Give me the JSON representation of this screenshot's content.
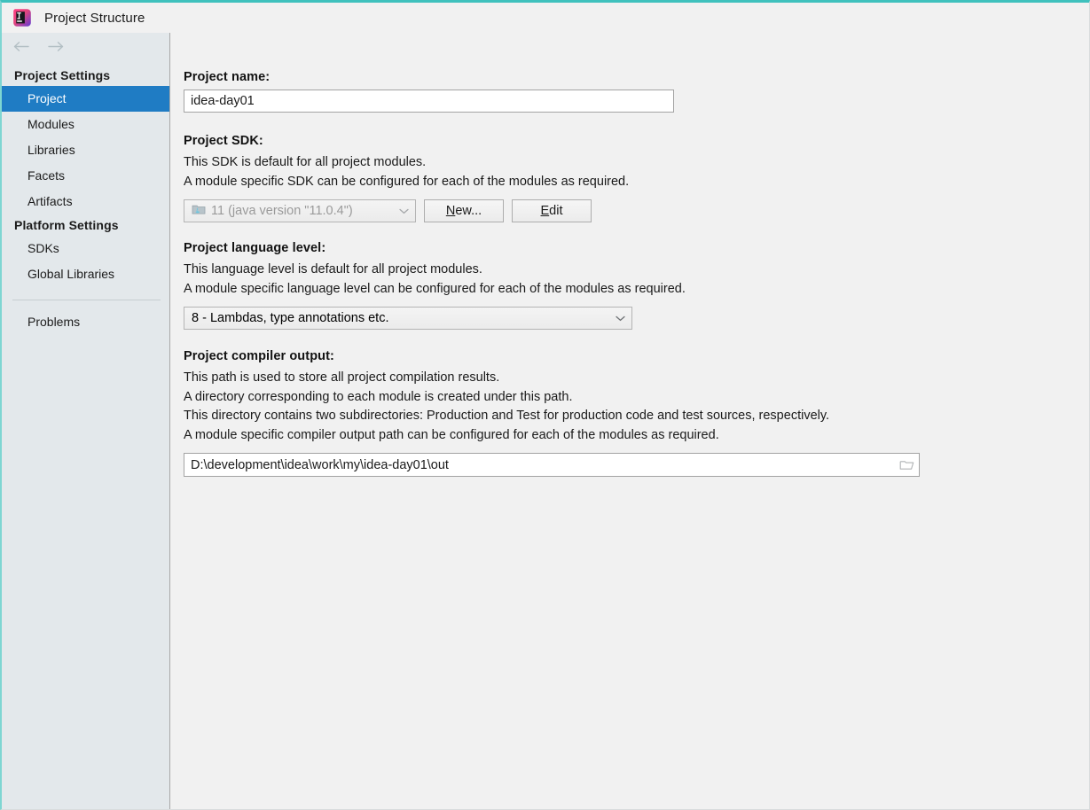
{
  "window": {
    "title": "Project Structure",
    "app_icon": "intellij-idea-logo-icon",
    "accent_color": "#3fc1bd",
    "selection_color": "#1f7cc4",
    "sidebar_bg": "#e3e8eb",
    "content_bg": "#f1f1f1"
  },
  "nav": {
    "back_icon": "arrow-left-icon",
    "forward_icon": "arrow-right-icon"
  },
  "sidebar": {
    "groups": [
      {
        "header": "Project Settings",
        "items": [
          {
            "label": "Project",
            "selected": true
          },
          {
            "label": "Modules",
            "selected": false
          },
          {
            "label": "Libraries",
            "selected": false
          },
          {
            "label": "Facets",
            "selected": false
          },
          {
            "label": "Artifacts",
            "selected": false
          }
        ]
      },
      {
        "header": "Platform Settings",
        "items": [
          {
            "label": "SDKs",
            "selected": false
          },
          {
            "label": "Global Libraries",
            "selected": false
          }
        ]
      }
    ],
    "footer_items": [
      {
        "label": "Problems",
        "selected": false
      }
    ]
  },
  "main": {
    "project_name": {
      "label": "Project name:",
      "value": "idea-day01",
      "placeholder": ""
    },
    "project_sdk": {
      "label": "Project SDK:",
      "desc_lines": [
        "This SDK is default for all project modules.",
        "A module specific SDK can be configured for each of the modules as required."
      ],
      "combo_icon": "java-sdk-icon",
      "combo_value": "11 (java version \"11.0.4\")",
      "combo_disabled": true,
      "chevron_icon": "chevron-down-icon",
      "new_button": "New...",
      "new_button_mnemonic": "N",
      "edit_button": "Edit",
      "edit_button_mnemonic": "E"
    },
    "language_level": {
      "label": "Project language level:",
      "desc_lines": [
        "This language level is default for all project modules.",
        "A module specific language level can be configured for each of the modules as required."
      ],
      "combo_value": "8 - Lambdas, type annotations etc.",
      "chevron_icon": "chevron-down-icon"
    },
    "compiler_output": {
      "label": "Project compiler output:",
      "desc_lines": [
        "This path is used to store all project compilation results.",
        "A directory corresponding to each module is created under this path.",
        "This directory contains two subdirectories: Production and Test for production code and test sources, respectively.",
        "A module specific compiler output path can be configured for each of the modules as required."
      ],
      "path_value": "D:\\development\\idea\\work\\my\\idea-day01\\out",
      "browse_icon": "folder-browse-icon"
    }
  }
}
